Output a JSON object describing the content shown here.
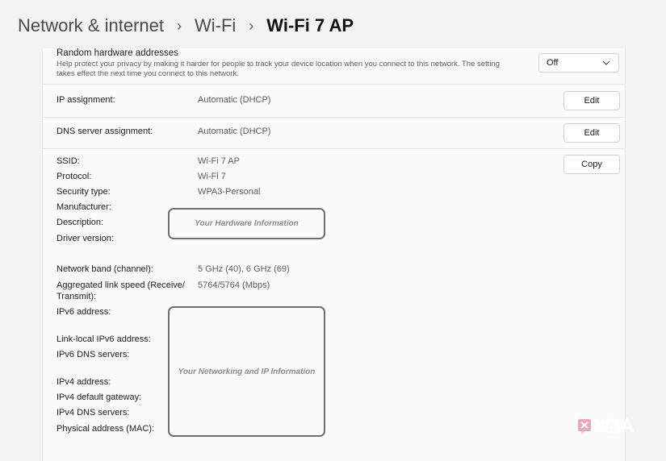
{
  "breadcrumb": {
    "items": [
      "Network & internet",
      "Wi-Fi"
    ],
    "current": "Wi-Fi 7 AP"
  },
  "random_mac": {
    "title": "Random hardware addresses",
    "description_line1": "Help protect your privacy by making it harder for people to track your device location when you connect to this network. The setting",
    "description_line2": "takes effect the next time you connect to this network.",
    "value": "Off"
  },
  "ip_assignment": {
    "label": "IP assignment:",
    "value": "Automatic (DHCP)",
    "button": "Edit"
  },
  "dns_assignment": {
    "label": "DNS server assignment:",
    "value": "Automatic (DHCP)",
    "button": "Edit"
  },
  "properties": {
    "copy_button": "Copy",
    "ssid_label": "SSID:",
    "ssid_value": "Wi-Fi 7 AP",
    "protocol_label": "Protocol:",
    "protocol_value": "Wi-Fi 7",
    "security_label": "Security type:",
    "security_value": "WPA3-Personal",
    "manufacturer_label": "Manufacturer:",
    "description_label": "Description:",
    "driver_label": "Driver version:",
    "band_label": "Network band (channel):",
    "band_value": "5 GHz (40), 6 GHz (69)",
    "link_speed_label_line1": "Aggregated link speed (Receive/",
    "link_speed_label_line2": "Transmit):",
    "link_speed_value": "5764/5764 (Mbps)",
    "ipv6_label": "IPv6 address:",
    "link_local_label": "Link-local IPv6 address:",
    "ipv6_dns_label": "IPv6 DNS servers:",
    "ipv4_label": "IPv4 address:",
    "ipv4_gateway_label": "IPv4 default gateway:",
    "ipv4_dns_label": "IPv4 DNS servers:",
    "mac_label": "Physical address (MAC):"
  },
  "overlays": {
    "hardware": "Your Hardware Information",
    "networking": "Your Networking and IP Information"
  },
  "watermark": {
    "text": "XDA"
  }
}
